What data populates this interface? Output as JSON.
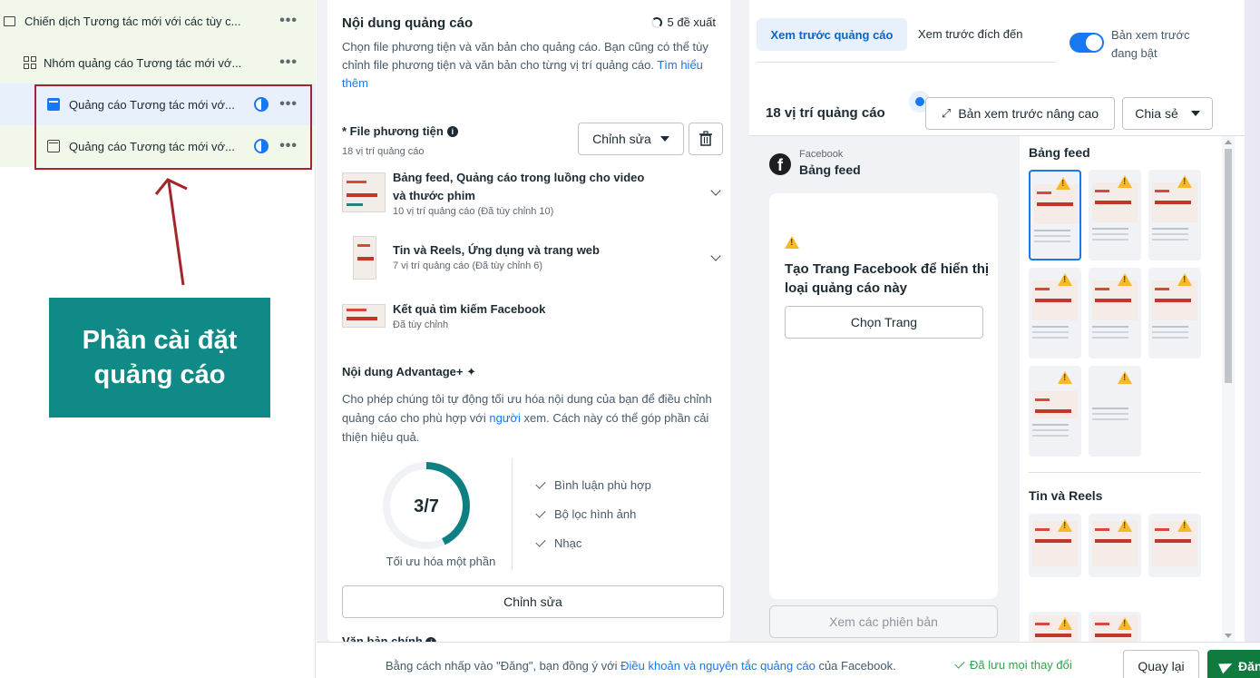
{
  "tree": {
    "campaign": "Chiến dịch Tương tác mới với các tùy c...",
    "adset": "Nhóm quảng cáo Tương tác mới vớ...",
    "ad1": "Quảng cáo Tương tác mới vớ...",
    "ad2": "Quảng cáo Tương tác mới vớ...",
    "more": "•••"
  },
  "callout": {
    "text": "Phần cài đặt quảng cáo",
    "color": "#108a87",
    "box_color": "#a3262a"
  },
  "creative": {
    "title": "Nội dung quảng cáo",
    "suggestions": "5 đề xuất",
    "description": "Chọn file phương tiện và văn bản cho quảng cáo. Bạn cũng có thể tùy chỉnh file phương tiện và văn bản cho từng vị trí quảng cáo.",
    "learn_more": "Tìm hiểu thêm",
    "media_label": "* File phương tiện",
    "media_sub": "18 vị trí quảng cáo",
    "edit_button": "Chỉnh sửa",
    "items": [
      {
        "title": "Bảng feed, Quảng cáo trong luồng cho video và thước phim",
        "sub": "10 vị trí quảng cáo (Đã tùy chỉnh 10)"
      },
      {
        "title": "Tin và Reels, Ứng dụng và trang web",
        "sub": "7 vị trí quảng cáo (Đã tùy chỉnh 6)"
      },
      {
        "title": "Kết quả tìm kiếm Facebook",
        "sub": "Đã tùy chỉnh"
      }
    ],
    "advantage_title": "Nội dung Advantage+",
    "advantage_desc_1": "Cho phép chúng tôi tự động tối ưu hóa nội dung của bạn để điều chỉnh quảng cáo cho phù hợp với ",
    "advantage_link": "người",
    "advantage_desc_2": " xem. Cách này có thể góp phần cải thiện hiệu quả.",
    "gauge_value": "3/7",
    "gauge_fraction": 0.4286,
    "gauge_label": "Tối ưu hóa một phần",
    "checks": [
      "Bình luận phù hợp",
      "Bộ lọc hình ảnh",
      "Nhạc"
    ],
    "advantage_edit": "Chỉnh sửa",
    "primary_text_label": "Văn bản chính"
  },
  "preview": {
    "tab_active": "Xem trước quảng cáo",
    "tab_dest": "Xem trước đích đến",
    "toggle_label": "Bản xem trước đang bật",
    "count_title": "18 vị trí quảng cáo",
    "advanced_button": "Bản xem trước nâng cao",
    "share_button": "Chia sẻ",
    "fb_small": "Facebook",
    "fb_place": "Bảng feed",
    "card_title": "Tạo Trang Facebook để hiển thị loại quảng cáo này",
    "choose_page": "Chọn Trang",
    "versions_button": "Xem các phiên bản",
    "feed_section": "Bảng feed",
    "stories_section": "Tin và Reels"
  },
  "footer": {
    "terms_1": "Bằng cách nhấp vào \"Đăng\", bạn đồng ý với ",
    "terms_link": "Điều khoản và nguyên tắc quảng cáo",
    "terms_2": " của Facebook.",
    "saved": "Đã lưu mọi thay đổi",
    "back": "Quay lại",
    "publish": "Đăng"
  }
}
